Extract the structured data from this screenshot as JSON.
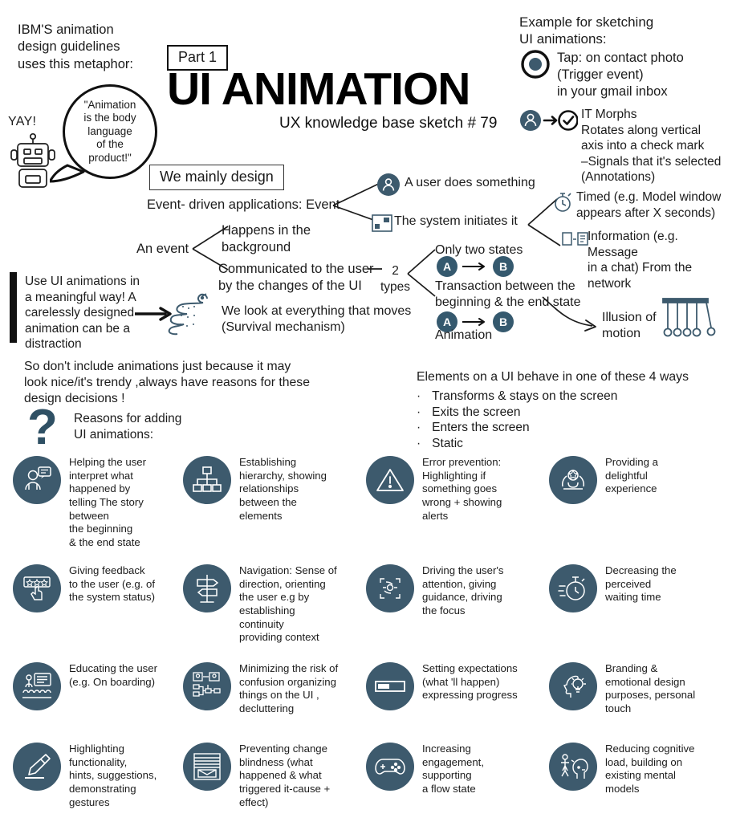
{
  "header": {
    "ibm_note": "IBM'S animation\ndesign guidelines\nuses this metaphor:",
    "yay": "YAY!",
    "bubble_quote": "\"Animation\nis the body\nlanguage\nof the\nproduct!\"",
    "part_badge": "Part 1",
    "title": "UI ANIMATION",
    "subtitle": "UX knowledge base sketch # 79",
    "robot_icon": "robot-icon"
  },
  "example": {
    "heading": "Example for sketching\nUI animations:",
    "items": [
      {
        "icon": "tap-target-icon",
        "text": "Tap: on contact photo\n(Trigger event)\nin your gmail inbox"
      },
      {
        "icon": "user-morph-check-icon",
        "text": "IT Morphs\nRotates along vertical\naxis into a check mark\n–Signals that it's selected\n(Annotations)"
      }
    ]
  },
  "diagram": {
    "we_mainly_design": "We mainly design",
    "event_driven": "Event- driven applications: Event",
    "branch_user": "A user does something",
    "branch_system": "The system initiates it",
    "user_icon": "user-avatar-icon",
    "system_icon": "system-window-icon",
    "timed_icon": "stopwatch-icon",
    "timed": "Timed (e.g. Model window\nappears after X seconds)",
    "info_icon": "message-exchange-icon",
    "information": "Information (e.g. Message\nin a chat) From the network",
    "an_event": "An event",
    "happens_background": "Happens in the\nbackground",
    "communicated": "Communicated to the user\nby the changes of the UI",
    "two_types": "2\ntypes",
    "only_two_states": "Only two states",
    "transaction": "Transaction between the\nbeginning & the end state",
    "animation_label": "Animation",
    "badge_a": "A",
    "badge_b": "B",
    "illusion": "Illusion of\nmotion",
    "cradle_icon": "newtons-cradle-icon",
    "snake_icon": "snake-icon",
    "snake_text": "We look at everything that moves\n(Survival mechanism)",
    "meaningful_callout": "Use UI animations in\na meaningful way! A\ncarelessly designed\nanimation can be a\ndistraction"
  },
  "main": {
    "dont_include": "So don't include animations just because it may\nlook nice/it's trendy ,always have reasons for these\ndesign decisions !",
    "question_icon": "question-mark-icon",
    "reasons_heading": "Reasons for adding\nUI animations:",
    "behave_heading": "Elements on a UI behave in one of these 4 ways",
    "behave_bullets": [
      "Transforms & stays on the screen",
      "Exits the screen",
      "Enters the screen",
      "Static"
    ],
    "bullet_glyph": "·"
  },
  "reasons": [
    {
      "icon": "user-speech-bubble-icon",
      "text": "Helping the user\ninterpret what\nhappened by\ntelling The story\nbetween\nthe beginning\n& the end state"
    },
    {
      "icon": "hierarchy-tree-icon",
      "text": "Establishing\nhierarchy, showing\nrelationships\nbetween the\nelements"
    },
    {
      "icon": "warning-triangle-icon",
      "text": "Error prevention:\nHighlighting if\nsomething goes\nwrong + showing\nalerts"
    },
    {
      "icon": "hands-holding-star-icon",
      "text": "Providing a\ndelightful\nexperience"
    },
    {
      "icon": "rating-stars-tap-icon",
      "text": "Giving feedback\nto the user (e.g. of\nthe system status)"
    },
    {
      "icon": "signpost-icon",
      "text": "Navigation: Sense of\ndirection, orienting\nthe user e.g  by\nestablishing\ncontinuity\nproviding context"
    },
    {
      "icon": "focus-target-hand-icon",
      "text": "Driving the user's\nattention, giving\nguidance, driving\nthe focus"
    },
    {
      "icon": "speed-stopwatch-icon",
      "text": "Decreasing the\nperceived\nwaiting time"
    },
    {
      "icon": "presentation-audience-icon",
      "text": "Educating the user\n(e.g. On boarding)"
    },
    {
      "icon": "flowchart-users-icon",
      "text": "Minimizing the risk of\nconfusion organizing\nthings on the UI ,\ndecluttering"
    },
    {
      "icon": "progress-bar-icon",
      "text": "Setting expectations\n(what 'll happen)\nexpressing progress"
    },
    {
      "icon": "head-lightbulb-icon",
      "text": "Branding &\nemotional design\npurposes, personal\ntouch"
    },
    {
      "icon": "highlighter-pen-icon",
      "text": "Highlighting\nfunctionality,\nhints, suggestions,\ndemonstrating\ngestures"
    },
    {
      "icon": "window-blinds-icon",
      "text": "Preventing change\nblindness (what\nhappened & what\ntriggered it-cause +\neffect)"
    },
    {
      "icon": "game-controller-icon",
      "text": "Increasing\nengagement,\nsupporting\na flow state"
    },
    {
      "icon": "person-head-profile-icon",
      "text": "Reducing cognitive\nload, building on\nexisting mental\nmodels"
    }
  ],
  "colors": {
    "circle_fill": "#3d5a6d",
    "badge_fill": "#35596e",
    "ink": "#1c1c1c",
    "background": "#ffffff"
  }
}
